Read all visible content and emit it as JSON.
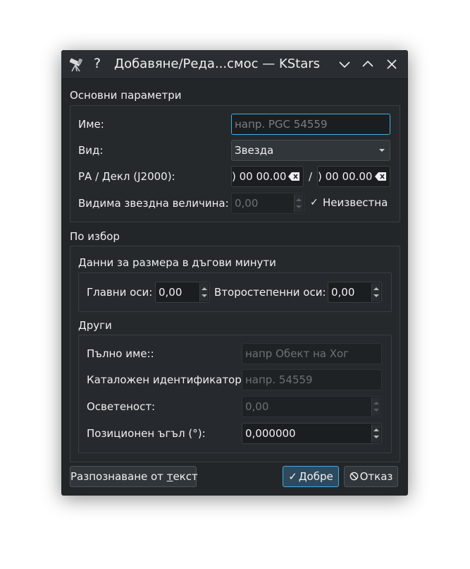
{
  "window": {
    "help_glyph": "?",
    "title": "Добавяне/Реда...смос — KStars"
  },
  "basic": {
    "header": "Основни параметри",
    "name_label": "Име:",
    "name_placeholder": "напр. PGC 54559",
    "type_label": "Вид:",
    "type_value": "Звезда",
    "radec_label": "РА / Декл (J2000):",
    "ra_value": ") 00 00.00",
    "separator": "/",
    "dec_value": ") 00 00.00",
    "mag_label": "Видима звездна величина:",
    "mag_value": "0,00",
    "unknown_label": "Неизвестна",
    "unknown_check": "✓"
  },
  "optional": {
    "header": "По избор",
    "size": {
      "header": "Данни за размера в дъгови минути",
      "major_label": "Главни оси:",
      "major_value": "0,00",
      "minor_label": "Второстепенни оси:",
      "minor_value": "0,00"
    },
    "other": {
      "header": "Други",
      "fullname_label": "Пълно име::",
      "fullname_placeholder": "напр Обект на Хог",
      "catalog_label": "Каталожен идентификатор:",
      "catalog_placeholder": "напр. 54559",
      "flux_label": "Осветеност:",
      "flux_value": "0,00",
      "pa_label": "Позиционен ъгъл (°):",
      "pa_value": "0,000000"
    }
  },
  "footer": {
    "parse_prefix": "Разпознаване от ",
    "parse_underlined": "т",
    "parse_suffix": "екст",
    "ok_icon": "✓",
    "ok_label": "Добре",
    "cancel_icon": "⃠",
    "cancel_label": "Отказ"
  }
}
